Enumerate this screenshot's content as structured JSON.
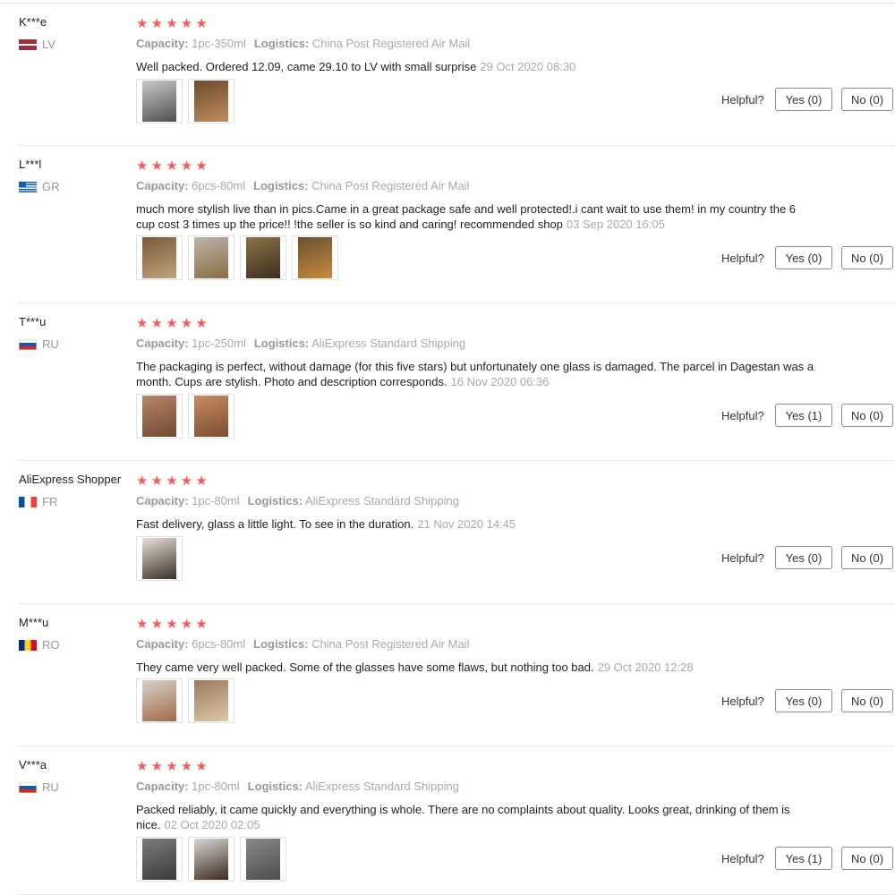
{
  "colors": {
    "star": "#f25c5c",
    "muted": "#aaaaaa",
    "separator": "#e8e8e8"
  },
  "labels": {
    "capacity": "Capacity:",
    "logistics": "Logistics:",
    "helpful": "Helpful?"
  },
  "reviews": [
    {
      "user": "K***e",
      "country": "LV",
      "rating": 5,
      "capacity": "1pc-350ml",
      "logistics": "China Post Registered Air Mail",
      "text": "Well packed. Ordered 12.09, came 29.10 to LV with small surprise",
      "date": "29 Oct 2020 08:30",
      "yes": "Yes (0)",
      "no": "No (0)",
      "photos": 2
    },
    {
      "user": "L***l",
      "country": "GR",
      "rating": 5,
      "capacity": "6pcs-80ml",
      "logistics": "China Post Registered Air Mail",
      "text": "much more stylish live than in pics.Came in a great package safe and well protected!.i cant wait to use them! in my country the 6 cup cost 3 times up the price!! !the seller is so kind and caring! recommended shop",
      "date": "03 Sep 2020 16:05",
      "yes": "Yes (0)",
      "no": "No (0)",
      "photos": 4
    },
    {
      "user": "T***u",
      "country": "RU",
      "rating": 5,
      "capacity": "1pc-250ml",
      "logistics": "AliExpress Standard Shipping",
      "text": "The packaging is perfect, without damage (for this five stars) but unfortunately one glass is damaged. The parcel in Dagestan was a month. Cups are stylish. Photo and description corresponds.",
      "date": "16 Nov 2020 06:36",
      "yes": "Yes (1)",
      "no": "No (0)",
      "photos": 2
    },
    {
      "user": "AliExpress Shopper",
      "country": "FR",
      "rating": 5,
      "capacity": "1pc-80ml",
      "logistics": "AliExpress Standard Shipping",
      "text": "Fast delivery, glass a little light. To see in the duration.",
      "date": "21 Nov 2020 14:45",
      "yes": "Yes (0)",
      "no": "No (0)",
      "photos": 1
    },
    {
      "user": "M***u",
      "country": "RO",
      "rating": 5,
      "capacity": "6pcs-80ml",
      "logistics": "China Post Registered Air Mail",
      "text": "They came very well packed. Some of the glasses have some flaws, but nothing too bad.",
      "date": "29 Oct 2020 12:28",
      "yes": "Yes (0)",
      "no": "No (0)",
      "photos": 2
    },
    {
      "user": "V***a",
      "country": "RU",
      "rating": 5,
      "capacity": "1pc-80ml",
      "logistics": "AliExpress Standard Shipping",
      "text": "Packed reliably, it came quickly and everything is whole. There are no complaints about quality. Looks great, drinking of them is nice.",
      "date": "02 Oct 2020 02:05",
      "yes": "Yes (1)",
      "no": "No (0)",
      "photos": 3
    }
  ]
}
